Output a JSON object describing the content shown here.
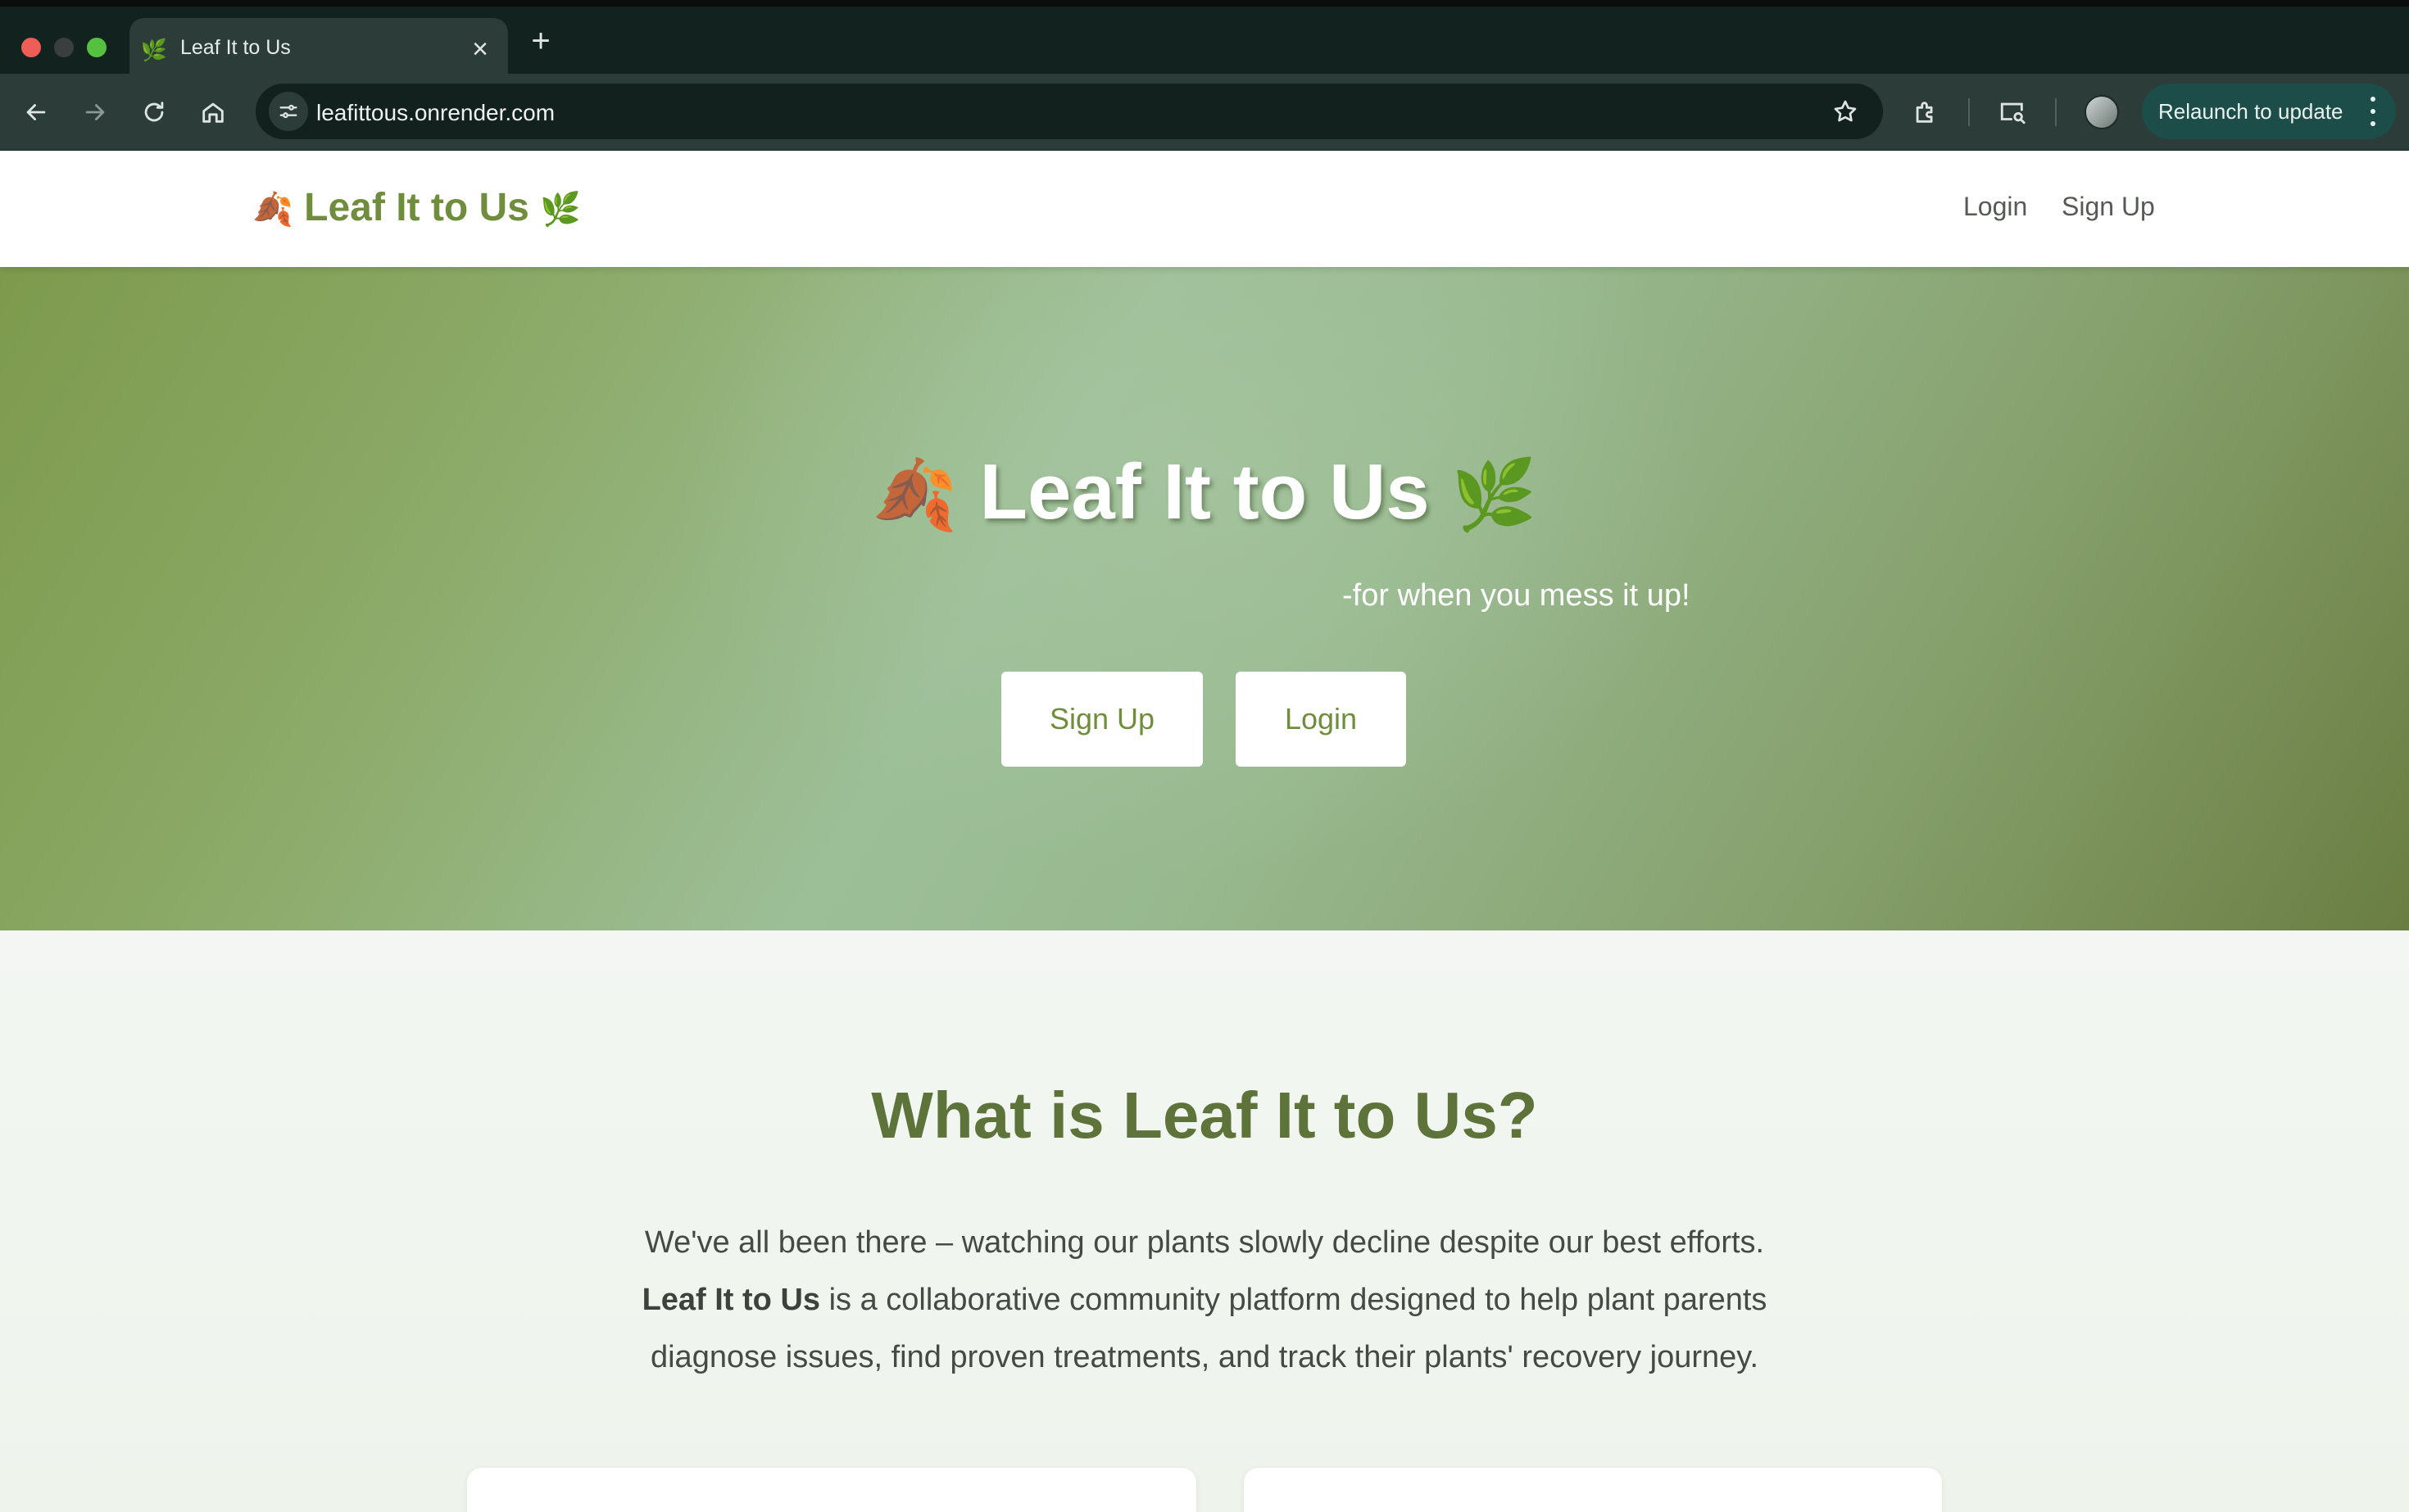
{
  "browser": {
    "tab_title": "Leaf It to Us",
    "tab_favicon": "🌿",
    "url": "leafittous.onrender.com",
    "relaunch_label": "Relaunch to update",
    "icons": [
      "back-icon",
      "forward-icon",
      "reload-icon",
      "home-icon",
      "site-info-icon",
      "star-icon",
      "extensions-icon",
      "tab-search-icon",
      "profile-avatar",
      "more-icon"
    ]
  },
  "nav": {
    "brand_leaf_left": "🍂",
    "brand_text": "Leaf It to Us",
    "brand_leaf_right": "🌿",
    "login": "Login",
    "signup": "Sign Up"
  },
  "hero": {
    "leaf_left": "🍂",
    "title": "Leaf It to Us",
    "leaf_right": "🌿",
    "tagline": "-for when you mess it up!",
    "signup_button": "Sign Up",
    "login_button": "Login"
  },
  "about": {
    "title": "What is Leaf It to Us?",
    "line1": "We've all been there – watching our plants slowly decline despite our best efforts.",
    "brand_bold": "Leaf It to Us",
    "line2_rest": " is a collaborative community platform designed to help plant parents",
    "line3": "diagnose issues, find proven treatments, and track their plants' recovery journey."
  },
  "colors": {
    "brand_green": "#6f8d3c",
    "heading_green": "#5e733a",
    "hero_gradient_start": "#7d9a4c",
    "hero_gradient_mid": "#9dbf98",
    "hero_gradient_end": "#6a7e42"
  }
}
